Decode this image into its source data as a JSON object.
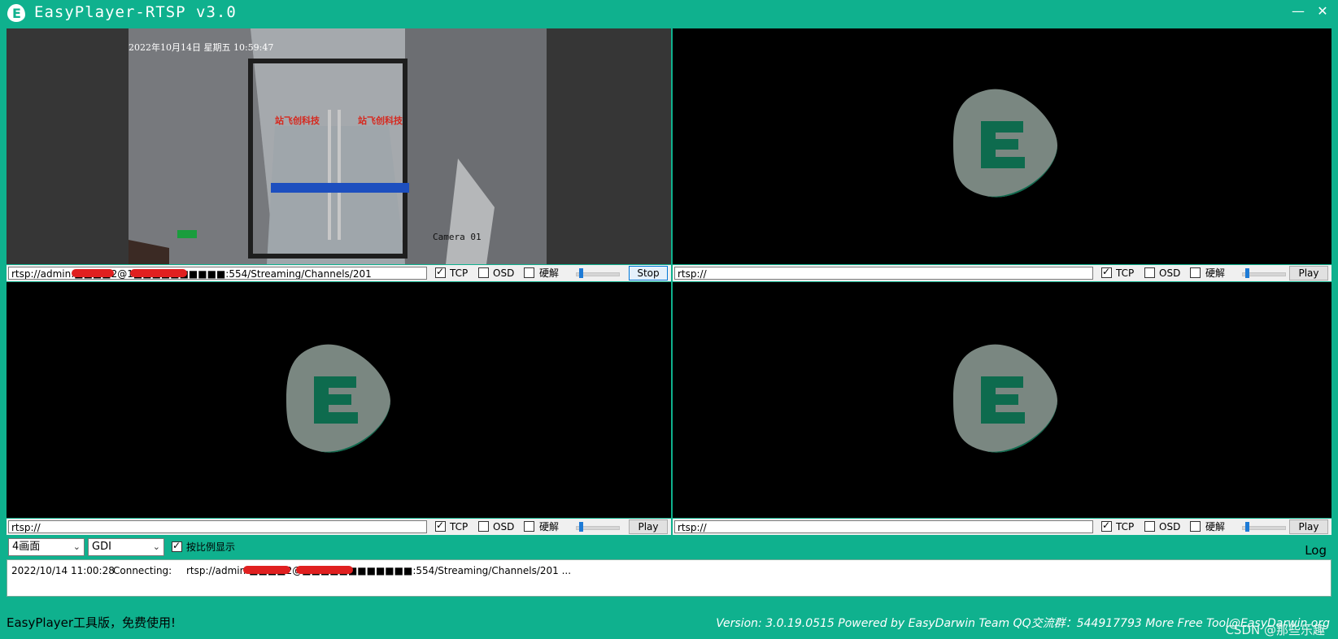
{
  "app": {
    "title": "EasyPlayer-RTSP v3.0",
    "minimize_glyph": "—",
    "close_glyph": "✕"
  },
  "camera": {
    "overlay_time": "2022年10月14日 星期五 10:59:47",
    "overlay_name": "Camera 01",
    "sign_left": "站飞创科技",
    "sign_right": "站飞创科技"
  },
  "panels": [
    {
      "url": "rtsp://admin:■■■■2@1■■■■■■■■■■:554/Streaming/Channels/201",
      "tcp": true,
      "osd": false,
      "hw_decode": false,
      "tcp_label": "TCP",
      "osd_label": "OSD",
      "hw_label": "硬解",
      "button": "Stop",
      "volume": 0.25
    },
    {
      "url": "rtsp://",
      "tcp": true,
      "osd": false,
      "hw_decode": false,
      "tcp_label": "TCP",
      "osd_label": "OSD",
      "hw_label": "硬解",
      "button": "Play",
      "volume": 0.25
    },
    {
      "url": "rtsp://",
      "tcp": true,
      "osd": false,
      "hw_decode": false,
      "tcp_label": "TCP",
      "osd_label": "OSD",
      "hw_label": "硬解",
      "button": "Play",
      "volume": 0.25
    },
    {
      "url": "rtsp://",
      "tcp": true,
      "osd": false,
      "hw_decode": false,
      "tcp_label": "TCP",
      "osd_label": "OSD",
      "hw_label": "硬解",
      "button": "Play",
      "volume": 0.25
    }
  ],
  "controls": {
    "layout_select": "4画面",
    "render_select": "GDI",
    "aspect_checkbox_label": "按比例显示",
    "aspect_checked": true,
    "log_label": "Log"
  },
  "log": {
    "timestamp": "2022/10/14 11:00:28",
    "status": "Connecting:",
    "url": "rtsp://admin:■■■■2@■■■■■■■■■■■■:554/Streaming/Channels/201 ..."
  },
  "status": {
    "left": "EasyPlayer工具版，免费使用!",
    "right": "Version: 3.0.19.0515 Powered by EasyDarwin Team QQ交流群：544917793    More Free Tool@EasyDarwin.org"
  },
  "watermark": "CSDN @那些乐趣",
  "colors": {
    "accent": "#0fb18e",
    "logo_gray": "#7a8781",
    "logo_e": "#0e6b4e"
  }
}
